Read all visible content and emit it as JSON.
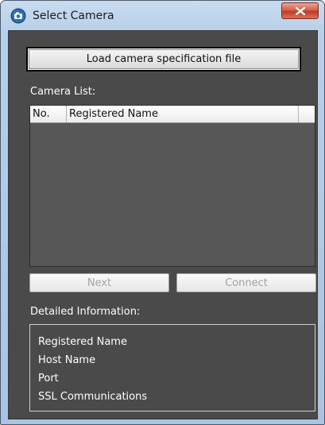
{
  "window": {
    "title": "Select Camera"
  },
  "buttons": {
    "load_spec": "Load camera specification file",
    "next": "Next",
    "connect": "Connect"
  },
  "camera_list": {
    "label": "Camera List:",
    "columns": [
      "No.",
      "Registered Name"
    ],
    "rows": []
  },
  "details": {
    "label": "Detailed Information:",
    "fields": [
      "Registered Name",
      "Host Name",
      "Port",
      "SSL Communications"
    ]
  },
  "icons": {
    "app": "camera-app-icon",
    "close": "close-icon"
  }
}
